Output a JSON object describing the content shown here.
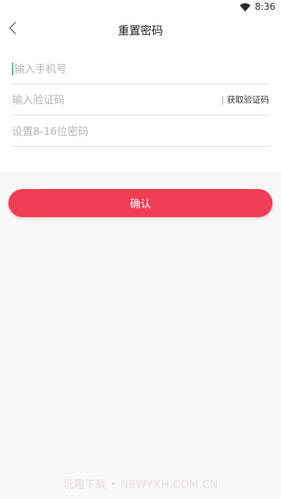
{
  "status_bar": {
    "time": "8:36",
    "wifi_icon": "wifi-icon"
  },
  "header": {
    "back_icon": "chevron-left-icon",
    "title": "重置密码"
  },
  "form": {
    "phone": {
      "value": "",
      "placeholder": "输入手机号"
    },
    "code": {
      "value": "",
      "placeholder": "输入验证码",
      "divider": "|",
      "button_label": "获取验证码"
    },
    "password": {
      "value": "",
      "placeholder": "设置8-16位密码"
    }
  },
  "confirm": {
    "label": "确认"
  },
  "watermark": {
    "text": "玩趣下载 • NBWYXH.COM.CN"
  },
  "colors": {
    "accent": "#f03e55",
    "caret": "#3bb7a8",
    "page_background": "#f8f8f8"
  }
}
